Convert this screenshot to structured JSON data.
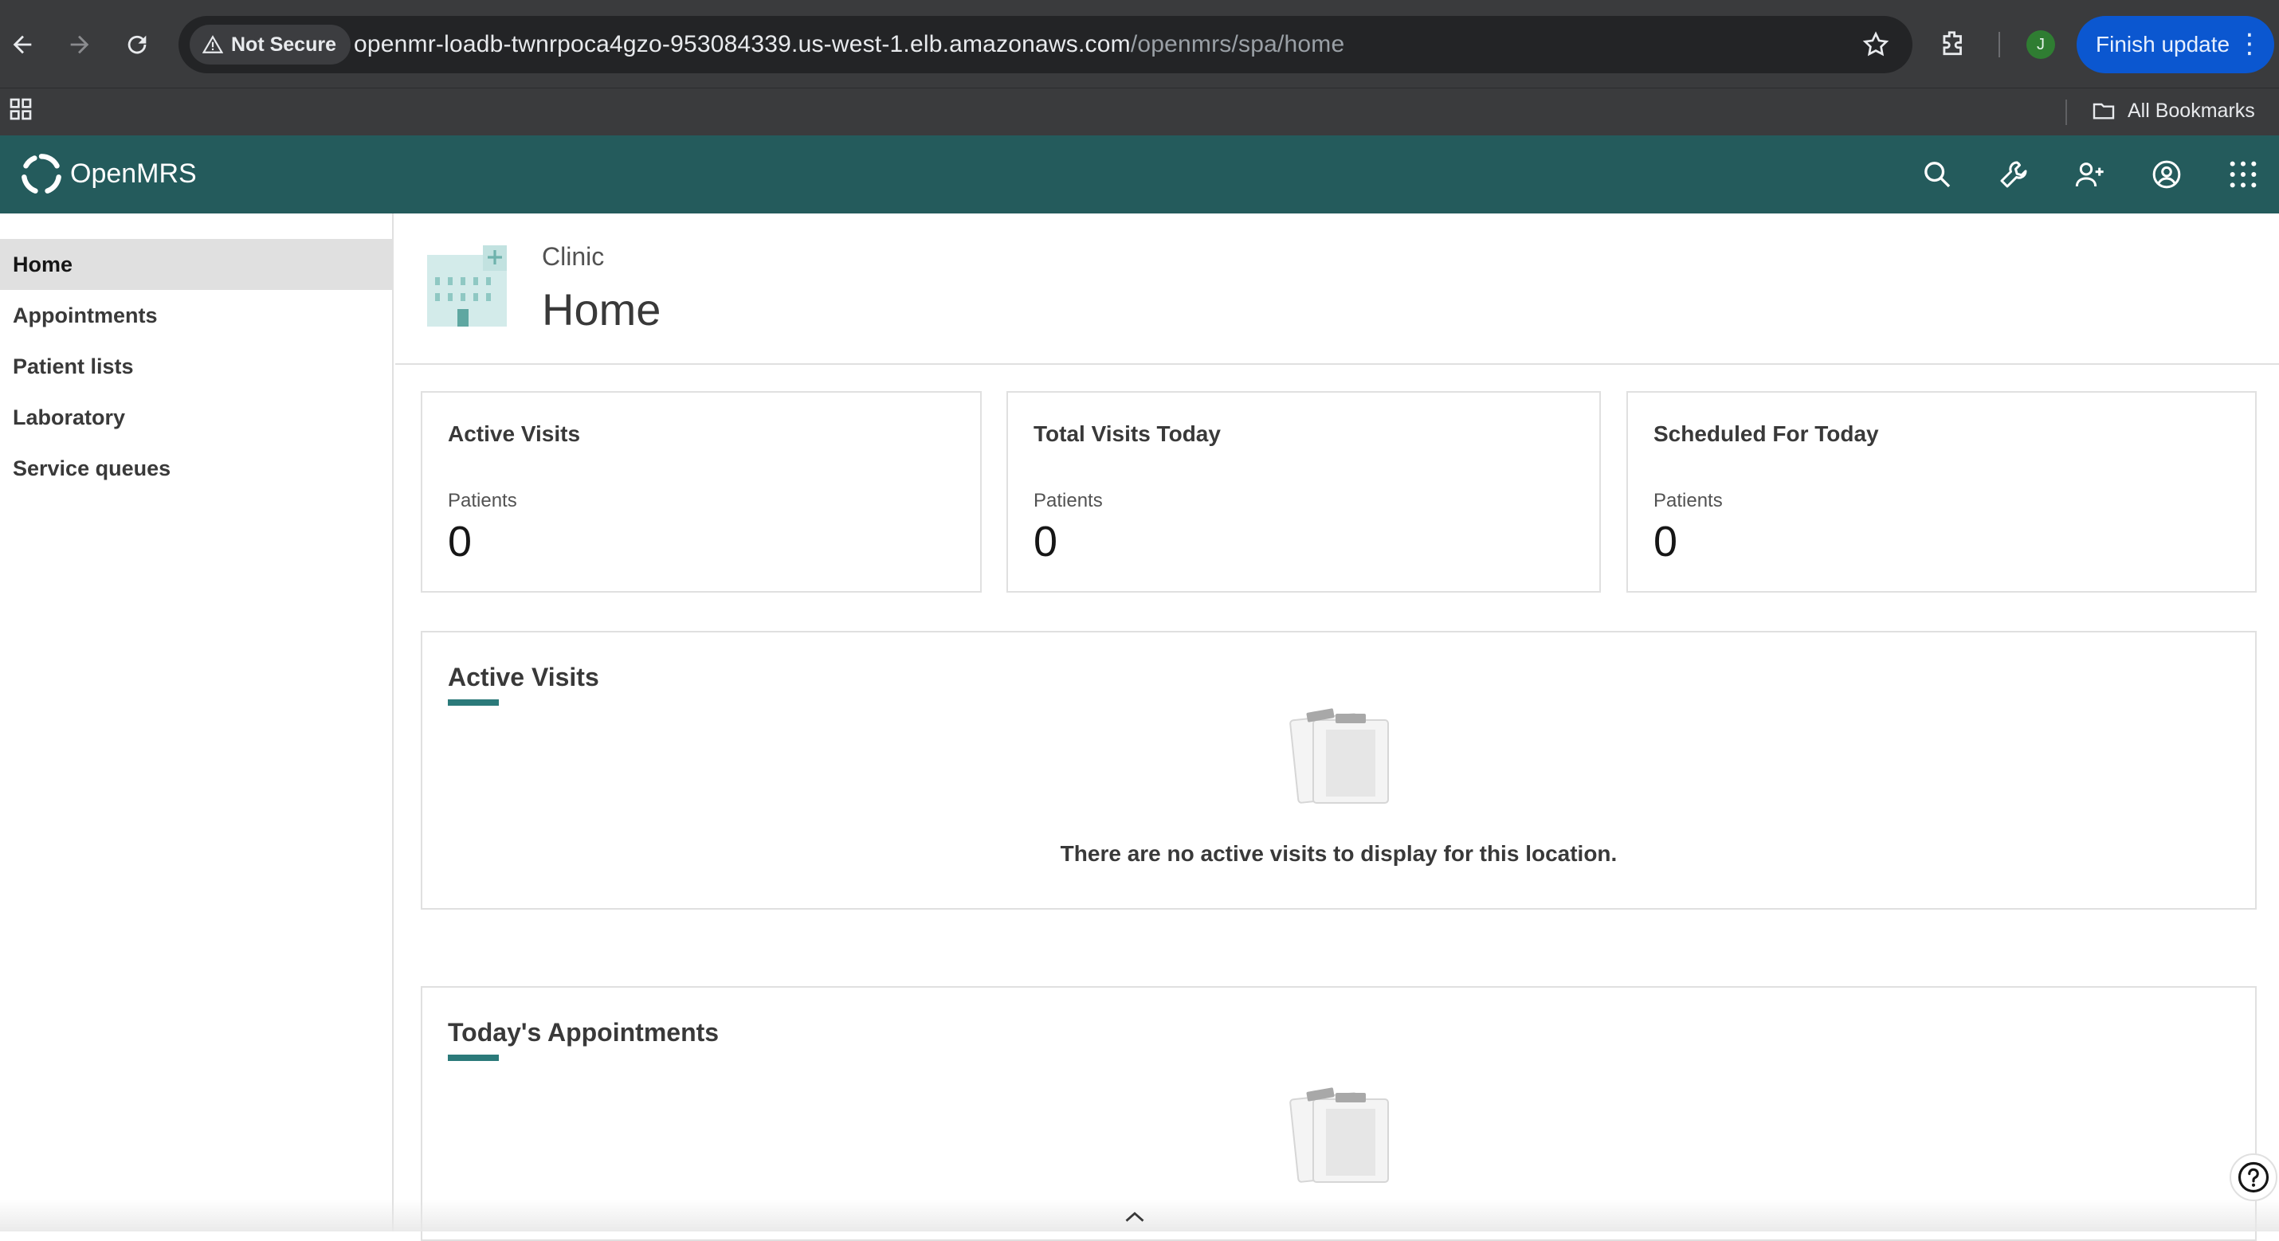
{
  "browser": {
    "security_label": "Not Secure",
    "url_host": "openmr-loadb-twnrpoca4gzo-953084339.us-west-1.elb.amazonaws.com",
    "url_path": "/openmrs/spa/home",
    "profile_initial": "J",
    "finish_update_label": "Finish update",
    "bookmarks_label": "All Bookmarks",
    "icons": [
      "back-icon",
      "forward-icon",
      "reload-icon",
      "warning-icon",
      "star-icon",
      "extensions-icon",
      "apps-icon",
      "folder-icon",
      "kebab-icon"
    ]
  },
  "header": {
    "brand": "OpenMRS",
    "color": "#245b5c",
    "icons": [
      "search-icon",
      "wrench-icon",
      "add-patient-icon",
      "user-avatar-icon",
      "app-switcher-icon"
    ]
  },
  "sidebar": {
    "items": [
      {
        "label": "Home",
        "active": true
      },
      {
        "label": "Appointments",
        "active": false
      },
      {
        "label": "Patient lists",
        "active": false
      },
      {
        "label": "Laboratory",
        "active": false
      },
      {
        "label": "Service queues",
        "active": false
      }
    ]
  },
  "banner": {
    "subtitle": "Clinic",
    "title": "Home"
  },
  "metrics": [
    {
      "title": "Active Visits",
      "label": "Patients",
      "value": "0"
    },
    {
      "title": "Total Visits Today",
      "label": "Patients",
      "value": "0"
    },
    {
      "title": "Scheduled For Today",
      "label": "Patients",
      "value": "0"
    }
  ],
  "active_visits": {
    "title": "Active Visits",
    "empty_message": "There are no active visits to display for this location."
  },
  "appointments": {
    "title": "Today's Appointments"
  },
  "accent_color": "#2b7a7a"
}
